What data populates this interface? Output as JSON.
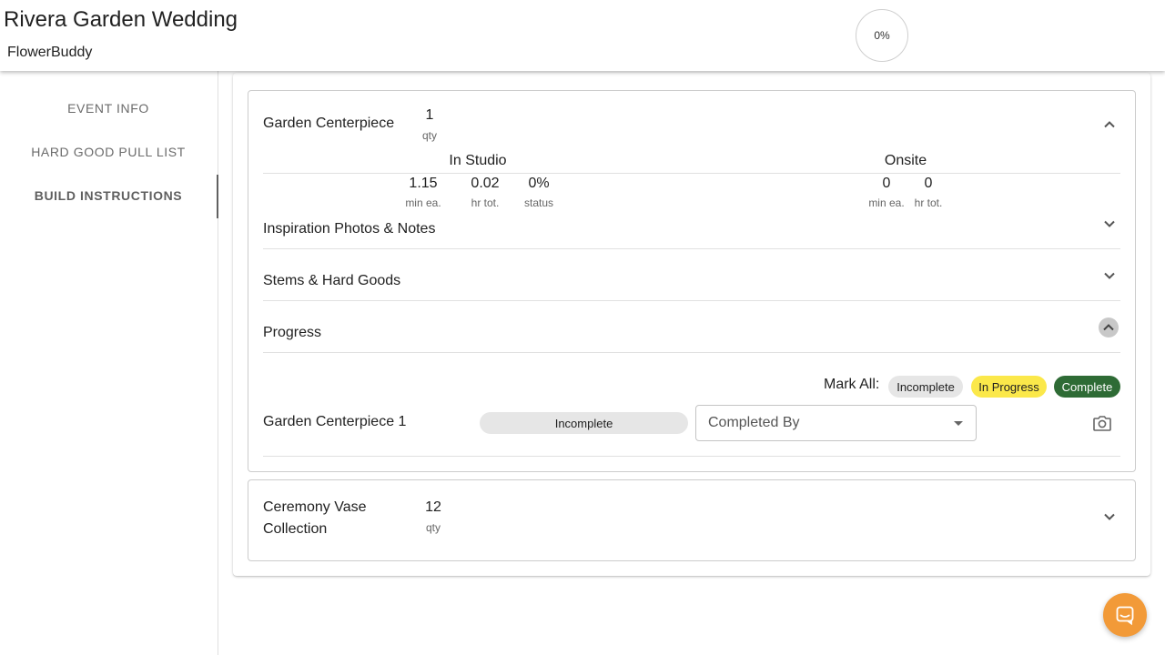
{
  "header": {
    "event_title": "Rivera Garden Wedding",
    "app_name": "FlowerBuddy",
    "overall_progress": "0%"
  },
  "sidebar": {
    "items": [
      {
        "label": "EVENT INFO"
      },
      {
        "label": "HARD GOOD PULL LIST"
      },
      {
        "label": "BUILD INSTRUCTIONS"
      }
    ]
  },
  "arrangements": [
    {
      "name": "Garden Centerpiece",
      "qty": "1",
      "qty_label": "qty",
      "in_studio": {
        "heading": "In Studio",
        "min_each": "1.15",
        "min_each_label": "min ea.",
        "hr_total": "0.02",
        "hr_total_label": "hr tot.",
        "status": "0%",
        "status_label": "status"
      },
      "onsite": {
        "heading": "Onsite",
        "min_each": "0",
        "min_each_label": "min ea.",
        "hr_total": "0",
        "hr_total_label": "hr tot."
      },
      "sections": [
        {
          "label": "Inspiration Photos & Notes"
        },
        {
          "label": "Stems & Hard Goods"
        },
        {
          "label": "Progress"
        }
      ],
      "progress": {
        "mark_all_label": "Mark All:",
        "chips": {
          "incomplete": "Incomplete",
          "in_progress": "In Progress",
          "complete": "Complete"
        },
        "items": [
          {
            "name": "Garden Centerpiece 1",
            "status": "Incomplete",
            "completed_by_placeholder": "Completed By"
          }
        ]
      }
    },
    {
      "name": "Ceremony Vase Collection",
      "name_line1": "Ceremony Vase",
      "name_line2": "Collection",
      "qty": "12",
      "qty_label": "qty"
    }
  ],
  "colors": {
    "in_progress": "#fbe84a",
    "complete": "#2e6b35",
    "incomplete": "#e6e6e6",
    "chat_button": "#f29a38"
  },
  "icons": {
    "collapse": "chevron-up-icon",
    "expand": "chevron-down-icon",
    "camera": "camera-icon",
    "chat": "chat-icon"
  }
}
